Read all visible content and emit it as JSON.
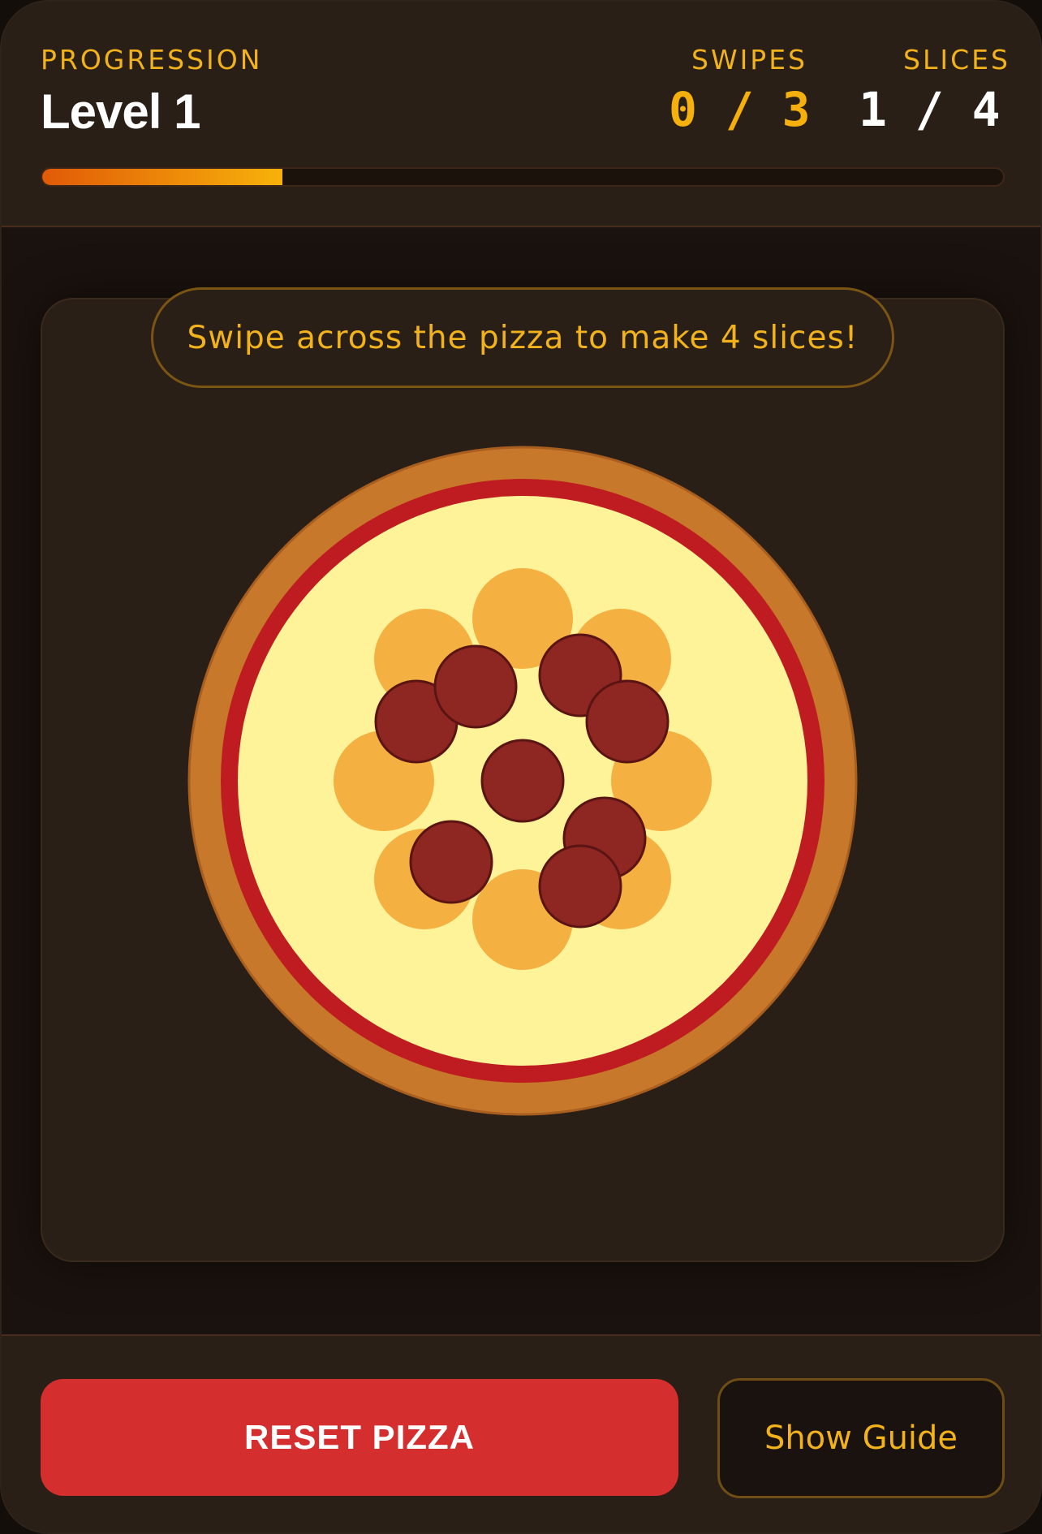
{
  "header": {
    "progression_label": "PROGRESSION",
    "level_title": "Level 1",
    "swipes_label": "SWIPES",
    "swipes_value": "0 / 3",
    "slices_label": "SLICES",
    "slices_value": "1 / 4",
    "progress_fraction": 0.25
  },
  "game": {
    "hint": "Swipe across the pizza to make 4 slices!",
    "pizza": {
      "toppings": [
        "cheese",
        "pepperoni"
      ]
    }
  },
  "footer": {
    "reset_label": "RESET PIZZA",
    "guide_label": "Show Guide"
  },
  "colors": {
    "accent": "#f2b21c",
    "reset_button": "#d42e2e",
    "crust": "#c8782a",
    "sauce": "#be1c20",
    "cheese_base": "#fff39a",
    "cheese_blob": "#f5b042",
    "pepperoni": "#8e2622"
  }
}
